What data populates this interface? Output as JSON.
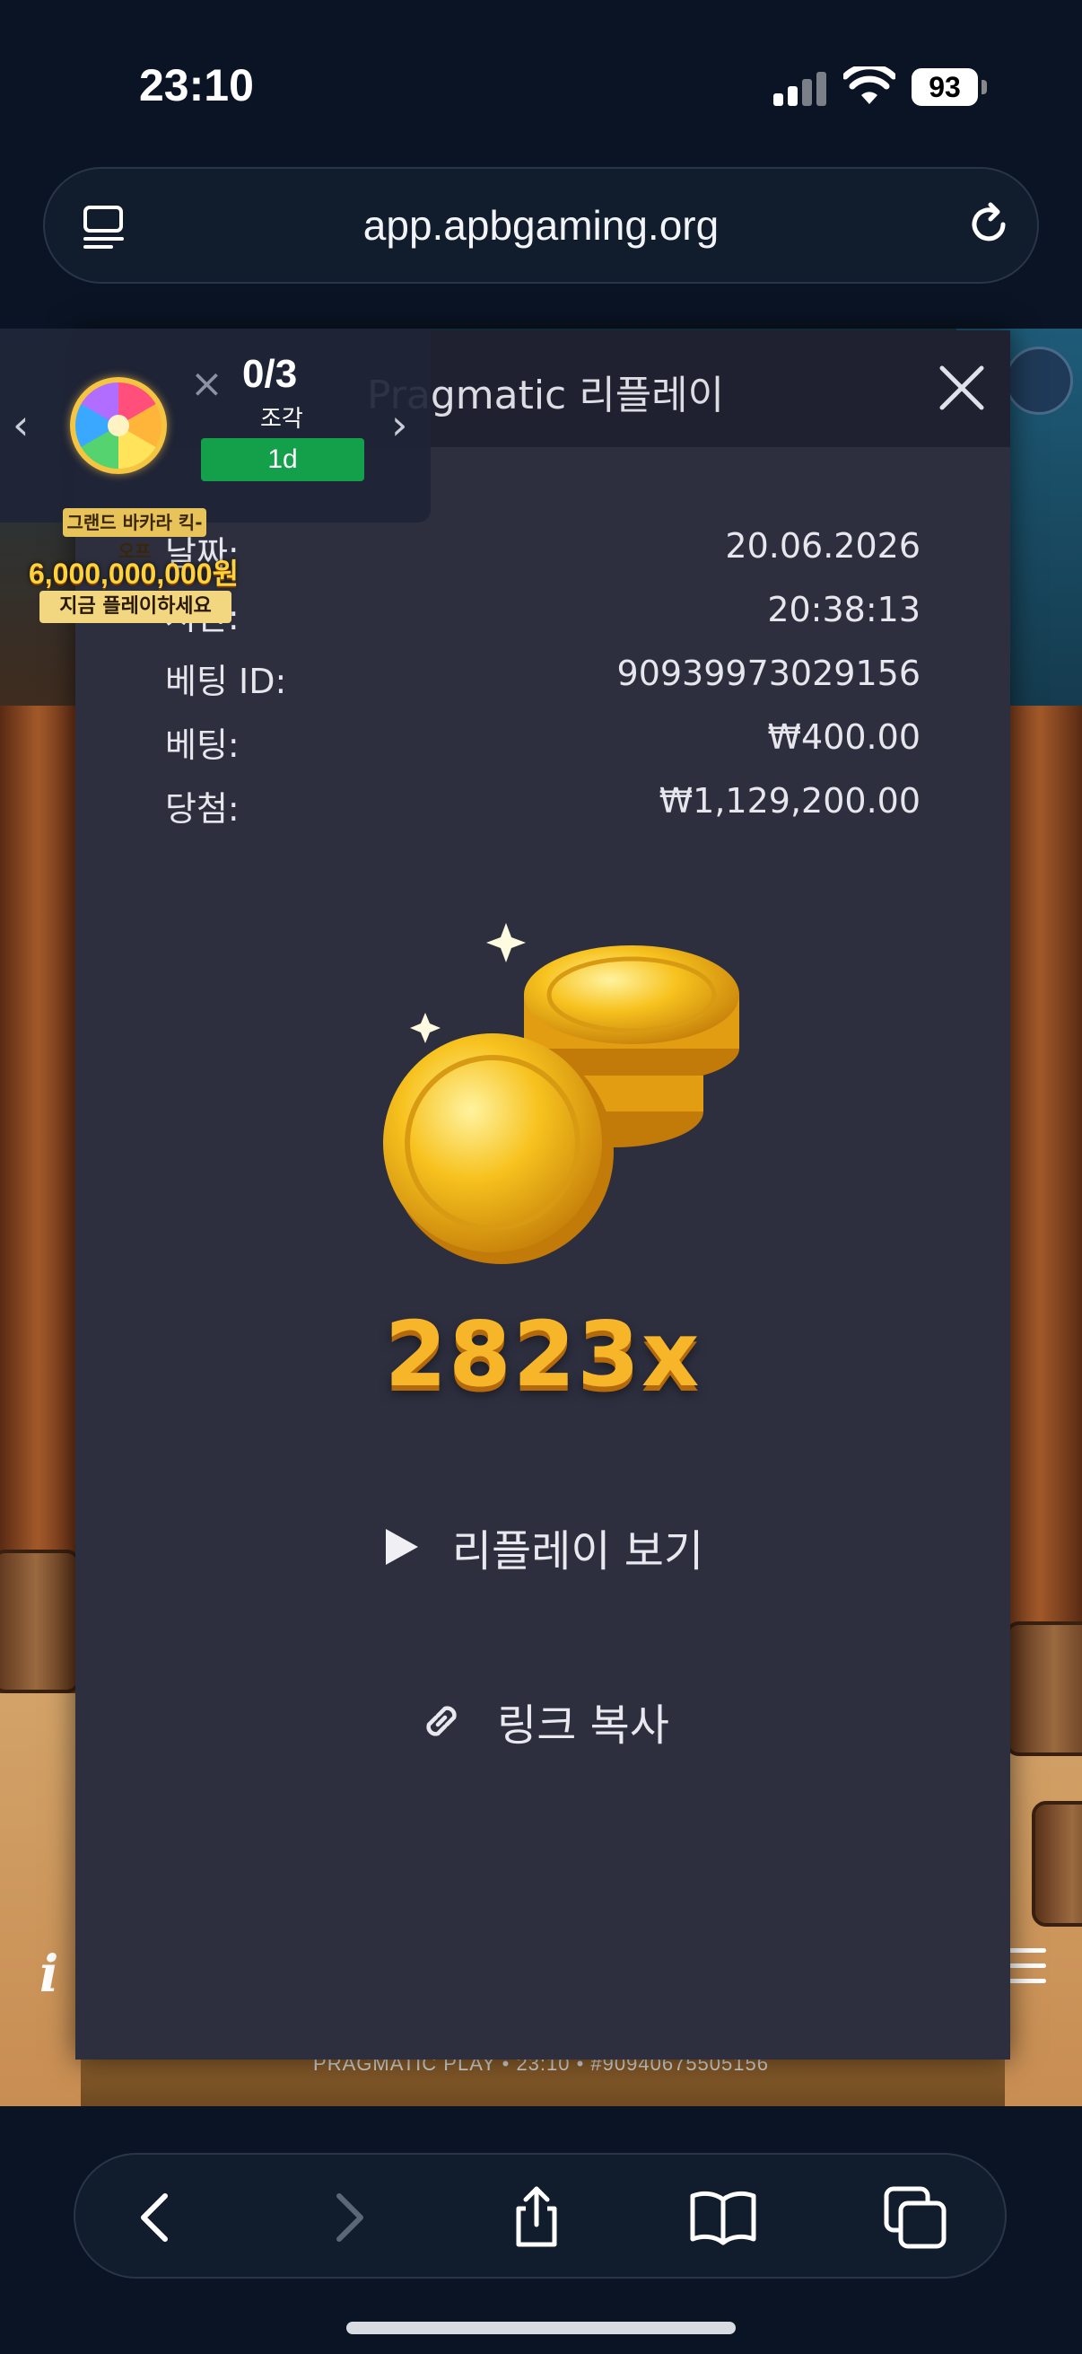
{
  "status_bar": {
    "time": "23:10",
    "battery": "93"
  },
  "browser": {
    "url": "app.apbgaming.org"
  },
  "promo_widget": {
    "count": "0/3",
    "unit": "조각",
    "badge": "1d",
    "ad_line1": "그랜드 바카라 킥-오프",
    "ad_line2": "6,000,000,000원",
    "ad_line3": "지금 플레이하세요"
  },
  "modal": {
    "title": "Pragmatic 리플레이",
    "details": [
      {
        "label": "날짜:",
        "value": "20.06.2026"
      },
      {
        "label": "시간:",
        "value": "20:38:13"
      },
      {
        "label": "베팅 ID:",
        "value": "90939973029156"
      },
      {
        "label": "베팅:",
        "value": "₩400.00"
      },
      {
        "label": "당첨:",
        "value": "₩1,129,200.00"
      }
    ],
    "multiplier": "2823x",
    "watch_replay": "리플레이 보기",
    "copy_link": "링크 복사"
  },
  "game": {
    "footer": "PRAGMATIC PLAY • 23:10 • #90940675505156"
  },
  "colors": {
    "modal_bg": "#2d2f3f",
    "multiplier": "#f7b52a",
    "badge": "#14a04a"
  }
}
